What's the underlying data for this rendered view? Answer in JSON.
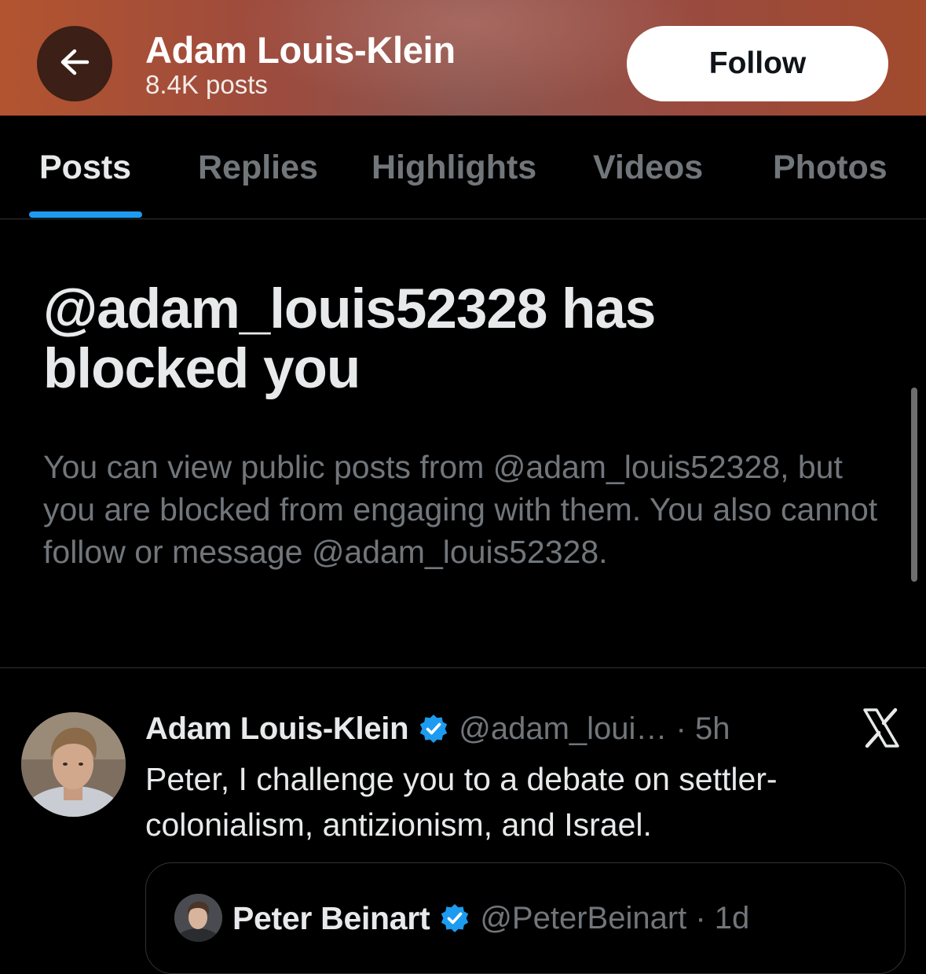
{
  "header": {
    "title": "Adam Louis-Klein",
    "subtitle": "8.4K posts",
    "follow_label": "Follow",
    "back_icon": "arrow-left-icon"
  },
  "tabs": [
    {
      "label": "Posts",
      "active": true
    },
    {
      "label": "Replies",
      "active": false
    },
    {
      "label": "Highlights",
      "active": false
    },
    {
      "label": "Videos",
      "active": false
    },
    {
      "label": "Photos",
      "active": false
    }
  ],
  "blocked": {
    "title": "@adam_louis52328 has blocked you",
    "text": "You can view public posts from @adam_louis52328, but you are blocked from engaging with them. You also cannot follow or message @adam_louis52328."
  },
  "post": {
    "name": "Adam Louis-Klein",
    "handle_time": "@adam_loui… · 5h",
    "text": "Peter, I challenge you to a debate on settler-colonialism, antizionism, and Israel.",
    "source_icon": "x-logo-icon",
    "verified_icon": "verified-badge-icon"
  },
  "quote": {
    "name": "Peter Beinart",
    "handle_time": "@PeterBeinart · 1d"
  },
  "colors": {
    "accent": "#1d9bf0",
    "background": "#000000",
    "text_primary": "#e7e9ea",
    "text_secondary": "#71767b",
    "header_tint": "#a14a2d"
  }
}
